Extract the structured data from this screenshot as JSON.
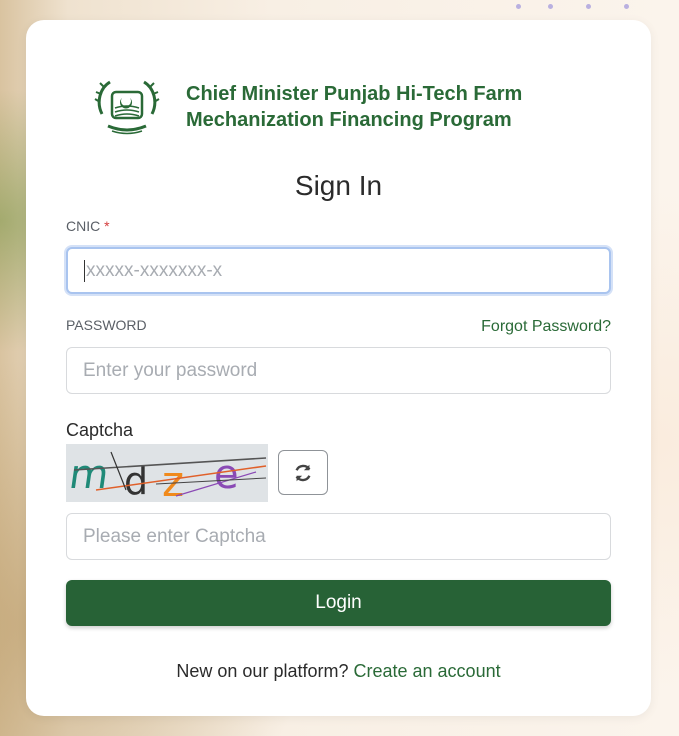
{
  "brand": {
    "title_line1": "Chief Minister Punjab Hi-Tech Farm",
    "title_line2": "Mechanization Financing Program"
  },
  "form": {
    "heading": "Sign In",
    "cnic": {
      "label": "CNIC",
      "required_mark": "*",
      "placeholder": "xxxxx-xxxxxxx-x",
      "value": ""
    },
    "password": {
      "label": "PASSWORD",
      "placeholder": "Enter your password",
      "value": "",
      "forgot_link": "Forgot Password?"
    },
    "captcha": {
      "label": "Captcha",
      "image_text": "mdze",
      "placeholder": "Please enter Captcha",
      "value": ""
    },
    "login_label": "Login"
  },
  "footer": {
    "prompt": "New on our platform?",
    "create_link": "Create an account"
  },
  "colors": {
    "brand_green": "#2a6a37",
    "button_green": "#276236",
    "focus_border": "#a9c4ef",
    "required_red": "#d43c3c"
  },
  "icons": {
    "refresh": "refresh-icon",
    "emblem": "punjab-emblem-icon"
  }
}
